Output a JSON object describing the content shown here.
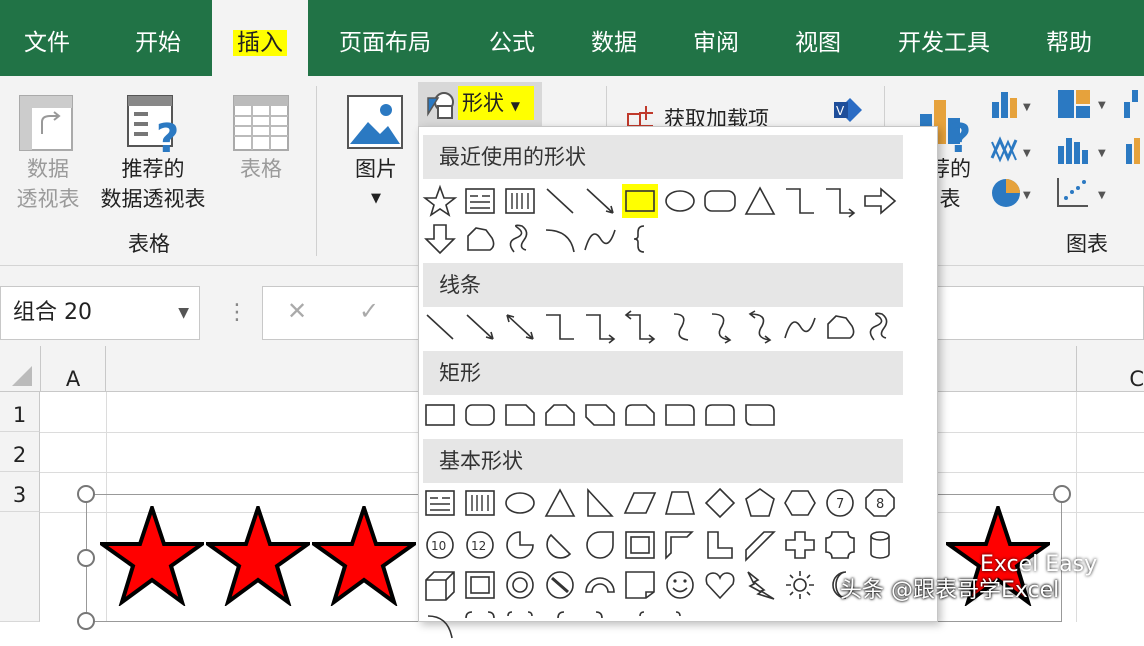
{
  "menu_tabs": [
    "文件",
    "开始",
    "插入",
    "页面布局",
    "公式",
    "数据",
    "审阅",
    "视图",
    "开发工具",
    "帮助"
  ],
  "active_tab": "插入",
  "ribbon": {
    "pivot_label": [
      "数据",
      "透视表"
    ],
    "recommended_pivot_label": [
      "推荐的",
      "数据透视表"
    ],
    "table_label": "表格",
    "group_tables": "表格",
    "picture_label": "图片",
    "shapes_button": "形状",
    "addins_label": "获取加载项",
    "recommended_charts_label": [
      "荐的",
      "表"
    ],
    "group_charts": "图表"
  },
  "namebox": "组合 20",
  "formula_icons": {
    "cancel": "✕",
    "enter": "✓"
  },
  "columns": [
    "A",
    "C"
  ],
  "rows": [
    "1",
    "2",
    "3"
  ],
  "shapes_panel": {
    "sections": [
      "最近使用的形状",
      "线条",
      "矩形",
      "基本形状"
    ]
  },
  "stars": {
    "fill": "#ff0000",
    "stroke": "#000000",
    "count": 4
  },
  "watermark": "头条 @跟表哥学Excel",
  "watermark2": "Excel Easy",
  "colors": {
    "excel_green": "#217346",
    "highlight": "#ffff00"
  }
}
